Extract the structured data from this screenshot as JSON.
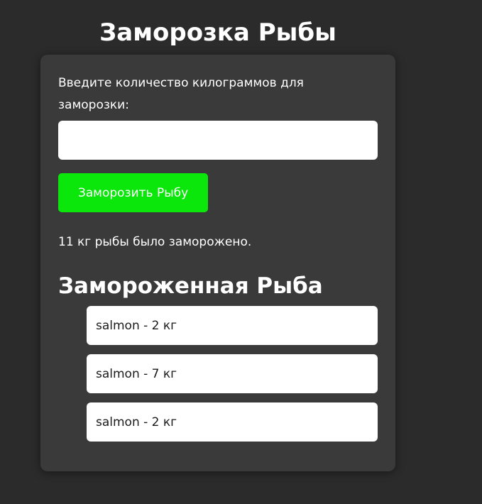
{
  "page": {
    "title": "Заморозка Рыбы"
  },
  "form": {
    "label": "Введите количество килограммов для заморозки:",
    "input_value": "",
    "input_placeholder": "",
    "button_label": "Заморозить Рыбу"
  },
  "status": {
    "message": "11 кг рыбы было заморожено."
  },
  "frozen": {
    "title": "Замороженная Рыба",
    "items": [
      {
        "label": "salmon - 2 кг"
      },
      {
        "label": "salmon - 7 кг"
      },
      {
        "label": "salmon - 2 кг"
      }
    ]
  },
  "colors": {
    "background": "#2b2b2b",
    "card": "#3a3a3a",
    "button": "#0be60b",
    "text": "#ffffff"
  }
}
